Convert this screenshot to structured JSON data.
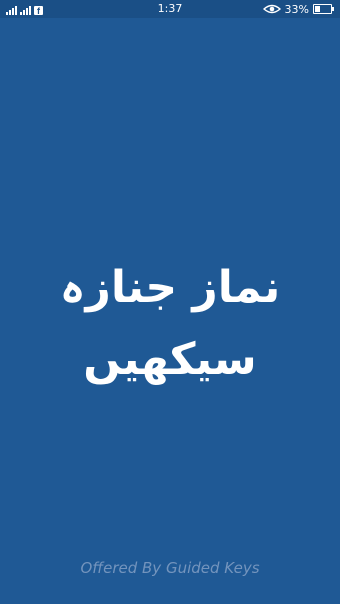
{
  "status_bar": {
    "time": "1:37",
    "battery_percent": "33%",
    "battery_level": 0.33,
    "icons": [
      "signal-icon",
      "facebook-icon",
      "eye-icon",
      "battery-icon"
    ]
  },
  "splash": {
    "title_line1": "نماز جنازہ",
    "title_line2": "سیکھیں",
    "footer": "Offered By Guided Keys"
  },
  "colors": {
    "background": "#1f5995",
    "status_bar": "#1a4f86",
    "title_text": "#ffffff",
    "footer_text": "#7394bd"
  }
}
